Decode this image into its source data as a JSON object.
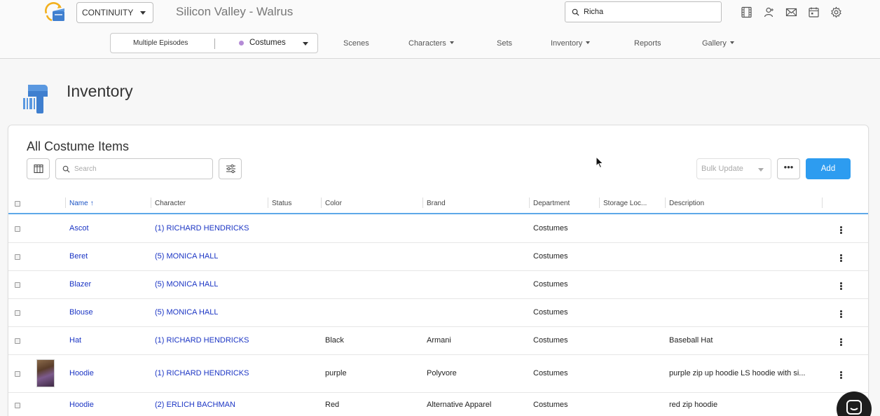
{
  "header": {
    "project_select": "CONTINUITY",
    "project_title": "Silicon Valley - Walrus",
    "search_value": "Richa"
  },
  "nav": {
    "segment_left": "Multiple Episodes",
    "segment_right": "Costumes",
    "segment_dot_color": "#b48bd6",
    "items": [
      {
        "label": "Scenes"
      },
      {
        "label": "Characters",
        "dropdown": true
      },
      {
        "label": "Sets"
      },
      {
        "label": "Inventory",
        "dropdown": true
      },
      {
        "label": "Reports"
      },
      {
        "label": "Gallery",
        "dropdown": true
      }
    ]
  },
  "page": {
    "title": "Inventory"
  },
  "card": {
    "title": "All Costume Items",
    "search_placeholder": "Search",
    "bulk_update": "Bulk Update",
    "more": "•••",
    "add": "Add"
  },
  "table": {
    "columns": [
      "Name",
      "Character",
      "Status",
      "Color",
      "Brand",
      "Department",
      "Storage Loc...",
      "Description"
    ],
    "sorted_column": "Name",
    "rows": [
      {
        "name": "Ascot",
        "character": "(1) RICHARD HENDRICKS",
        "status": "",
        "color": "",
        "brand": "",
        "department": "Costumes",
        "storage": "",
        "description": ""
      },
      {
        "name": "Beret",
        "character": "(5) MONICA HALL",
        "status": "",
        "color": "",
        "brand": "",
        "department": "Costumes",
        "storage": "",
        "description": ""
      },
      {
        "name": "Blazer",
        "character": "(5) MONICA HALL",
        "status": "",
        "color": "",
        "brand": "",
        "department": "Costumes",
        "storage": "",
        "description": ""
      },
      {
        "name": "Blouse",
        "character": "(5) MONICA HALL",
        "status": "",
        "color": "",
        "brand": "",
        "department": "Costumes",
        "storage": "",
        "description": ""
      },
      {
        "name": "Hat",
        "character": "(1) RICHARD HENDRICKS",
        "status": "",
        "color": "Black",
        "brand": "Armani",
        "department": "Costumes",
        "storage": "",
        "description": "Baseball Hat"
      },
      {
        "name": "Hoodie",
        "character": "(1) RICHARD HENDRICKS",
        "status": "",
        "color": "purple",
        "brand": "Polyvore",
        "department": "Costumes",
        "storage": "",
        "description": "purple zip up hoodie LS hoodie with si..."
      },
      {
        "name": "Hoodie",
        "character": "(2) ERLICH BACHMAN",
        "status": "",
        "color": "Red",
        "brand": "Alternative Apparel",
        "department": "Costumes",
        "storage": "",
        "description": "red zip hoodie"
      }
    ]
  },
  "colors": {
    "accent": "#2d9cf0",
    "link": "#1b35c4",
    "header_rule": "#5ea8e8"
  }
}
